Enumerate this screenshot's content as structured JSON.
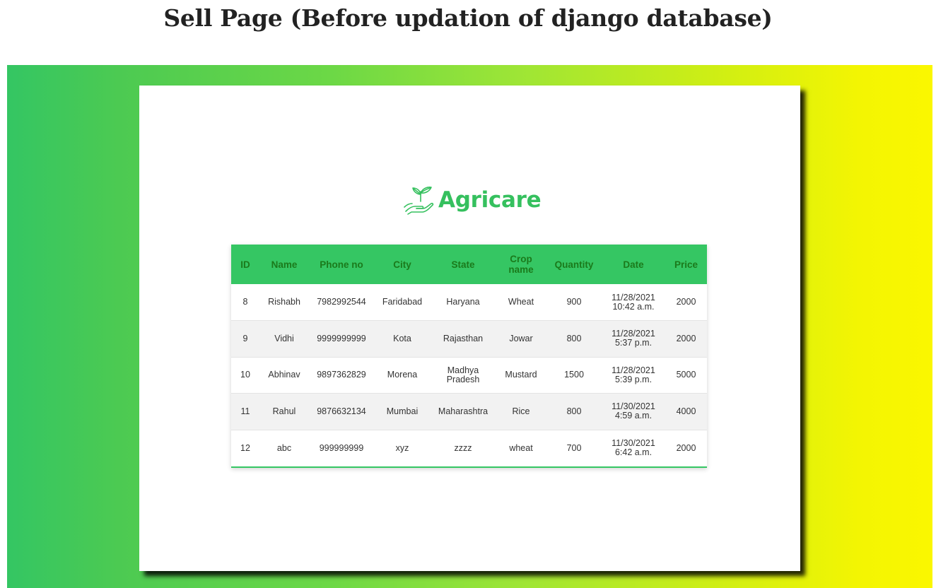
{
  "caption": "Sell Page (Before updation of django database)",
  "brand": {
    "name": "Agricare",
    "icon": "plant-in-hand-icon",
    "color": "#35c05e"
  },
  "colors": {
    "header_bg": "#35c663",
    "header_text": "#1b7a1b",
    "gradient_start": "#34c663",
    "gradient_end": "#fbf700"
  },
  "table": {
    "headers": [
      "ID",
      "Name",
      "Phone no",
      "City",
      "State",
      "Crop name",
      "Quantity",
      "Date",
      "Price"
    ],
    "rows": [
      [
        "8",
        "Rishabh",
        "7982992544",
        "Faridabad",
        "Haryana",
        "Wheat",
        "900",
        "11/28/2021 10:42 a.m.",
        "2000"
      ],
      [
        "9",
        "Vidhi",
        "9999999999",
        "Kota",
        "Rajasthan",
        "Jowar",
        "800",
        "11/28/2021 5:37 p.m.",
        "2000"
      ],
      [
        "10",
        "Abhinav",
        "9897362829",
        "Morena",
        "Madhya Pradesh",
        "Mustard",
        "1500",
        "11/28/2021 5:39 p.m.",
        "5000"
      ],
      [
        "11",
        "Rahul",
        "9876632134",
        "Mumbai",
        "Maharashtra",
        "Rice",
        "800",
        "11/30/2021 4:59 a.m.",
        "4000"
      ],
      [
        "12",
        "abc",
        "999999999",
        "xyz",
        "zzzz",
        "wheat",
        "700",
        "11/30/2021 6:42 a.m.",
        "2000"
      ]
    ]
  }
}
